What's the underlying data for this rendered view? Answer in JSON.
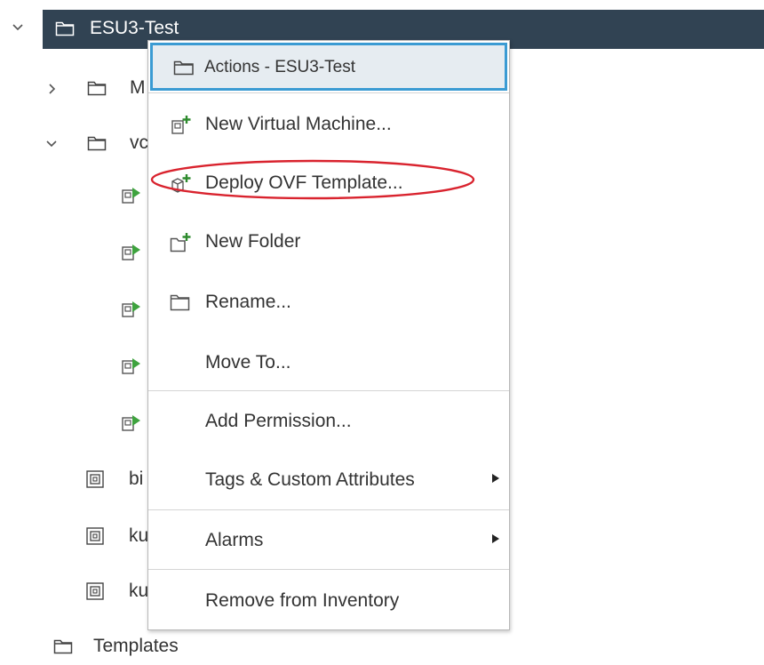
{
  "tree": {
    "root": {
      "label": "ESU3-Test",
      "expanded": true,
      "selected": true
    },
    "items": [
      {
        "label": "M",
        "expanded": false,
        "kind": "folder"
      },
      {
        "label": "vc",
        "expanded": true,
        "kind": "folder"
      },
      {
        "label": "",
        "kind": "vm-running"
      },
      {
        "label": "",
        "kind": "vm-running"
      },
      {
        "label": "",
        "kind": "vm-running"
      },
      {
        "label": "",
        "kind": "vm-running"
      },
      {
        "label": "",
        "kind": "vm-running"
      },
      {
        "label": "bi",
        "kind": "template"
      },
      {
        "label": "ku",
        "kind": "template"
      },
      {
        "label": "ku",
        "kind": "template"
      },
      {
        "label": "Templates",
        "kind": "folder"
      }
    ]
  },
  "menu": {
    "header": "Actions - ESU3-Test",
    "items": [
      {
        "label": "New Virtual Machine...",
        "icon": "new-vm-icon"
      },
      {
        "label": "Deploy OVF Template...",
        "icon": "deploy-ovf-icon"
      },
      {
        "label": "New Folder",
        "icon": "new-folder-icon"
      },
      {
        "label": "Rename...",
        "icon": "folder-icon"
      },
      {
        "label": "Move To..."
      },
      {
        "label": "Add Permission..."
      },
      {
        "label": "Tags & Custom Attributes",
        "submenu": true
      },
      {
        "label": "Alarms",
        "submenu": true
      },
      {
        "label": "Remove from Inventory"
      }
    ]
  },
  "colors": {
    "selected_row": "#314353",
    "header_border": "#3b9bd3",
    "header_bg": "#e6ecf1",
    "plus_green": "#2e8b2e",
    "vm_green": "#3fa33f",
    "annotation_red": "#d9232e"
  }
}
